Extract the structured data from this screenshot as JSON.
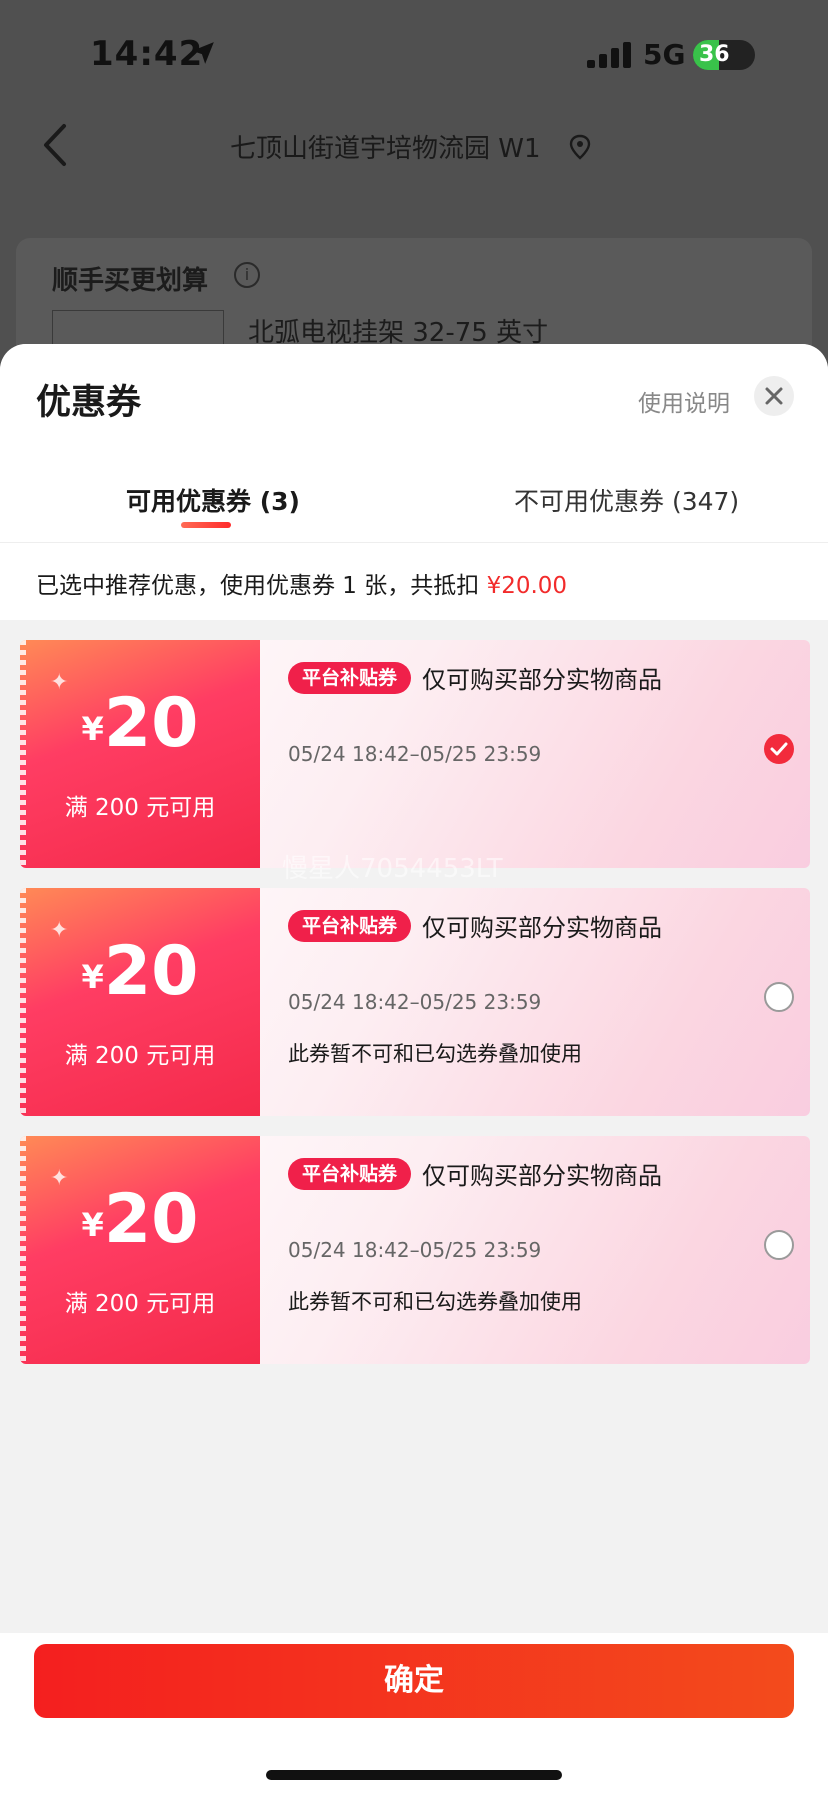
{
  "status_bar": {
    "time": "14:42",
    "network": "5G",
    "battery": "36"
  },
  "nav": {
    "title": "七顶山街道宇培物流园 W1"
  },
  "background_card": {
    "title": "顺手买更划算",
    "product_name": "北弧电视挂架 32-75 英寸"
  },
  "sheet": {
    "title": "优惠券",
    "help_link": "使用说明",
    "tabs": [
      {
        "label": "可用优惠券 (3)",
        "active": true
      },
      {
        "label": "不可用优惠券 (347)",
        "active": false
      }
    ],
    "summary_text": "已选中推荐优惠，使用优惠券 1 张，共抵扣 ",
    "summary_amount": "¥20.00"
  },
  "coupons": [
    {
      "currency": "¥",
      "amount": "20",
      "condition": "满 200 元可用",
      "badge": "平台补贴券",
      "scope": "仅可购买部分实物商品",
      "date": "05/24 18:42–05/25 23:59",
      "note": "",
      "selected": true
    },
    {
      "currency": "¥",
      "amount": "20",
      "condition": "满 200 元可用",
      "badge": "平台补贴券",
      "scope": "仅可购买部分实物商品",
      "date": "05/24 18:42–05/25 23:59",
      "note": "此券暂不可和已勾选券叠加使用",
      "selected": false
    },
    {
      "currency": "¥",
      "amount": "20",
      "condition": "满 200 元可用",
      "badge": "平台补贴券",
      "scope": "仅可购买部分实物商品",
      "date": "05/24 18:42–05/25 23:59",
      "note": "此券暂不可和已勾选券叠加使用",
      "selected": false
    }
  ],
  "watermark": "慢星人7054453LT",
  "confirm_label": "确定",
  "colors": {
    "accent": "#f22b2b",
    "coupon_left": "#f42a4a"
  },
  "icons": [
    "location-arrow-icon",
    "signal-icon",
    "back-icon",
    "location-pin-icon",
    "info-icon",
    "close-icon",
    "check-icon"
  ]
}
